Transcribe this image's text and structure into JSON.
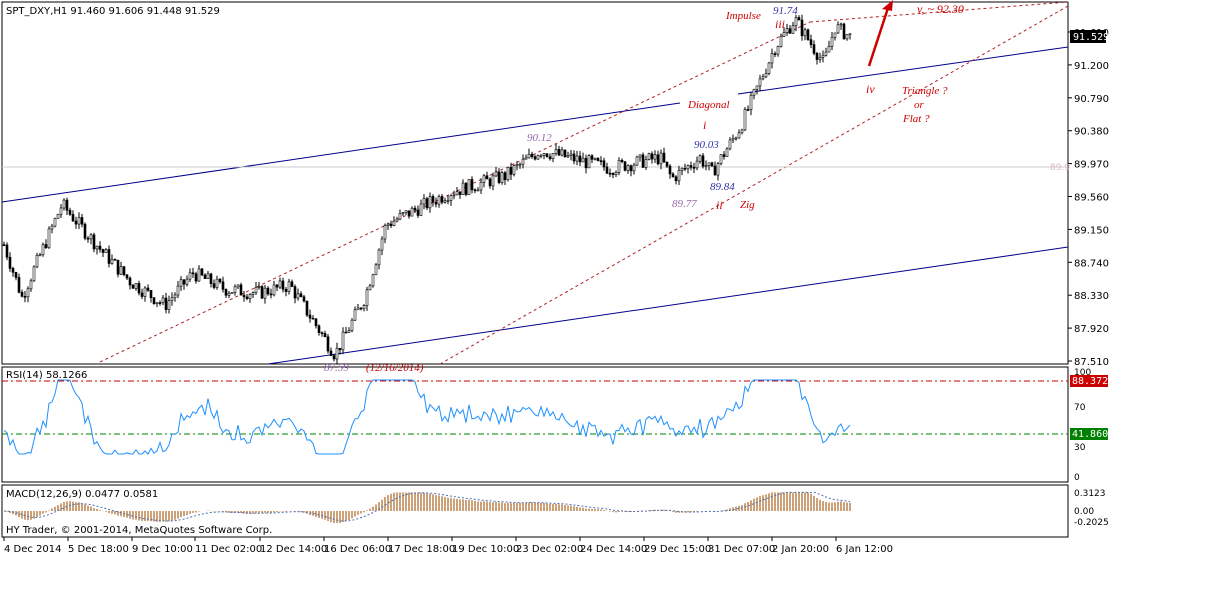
{
  "window": {
    "symbol_header": "SPT_DXY,H1  91.460 91.606 91.448 91.529",
    "copyright": "HY Trader, © 2001-2014, MetaQuotes Software Corp."
  },
  "price_axis": {
    "ticks": [
      "91.610",
      "91.200",
      "90.790",
      "90.380",
      "89.970",
      "89.560",
      "89.150",
      "88.740",
      "88.330",
      "87.920",
      "87.510"
    ],
    "current_price": "91.529",
    "faint_level_label": "89.9"
  },
  "rsi": {
    "header": "RSI(14) 58.1266",
    "ticks": [
      "100",
      "70",
      "30",
      "0"
    ],
    "upper_level": "88.3721",
    "lower_level": "41.8605"
  },
  "macd": {
    "header": "MACD(12,26,9) 0.0477 0.0581",
    "ticks": [
      "0.3123",
      "0.00",
      "-0.2025"
    ]
  },
  "time_axis": [
    "4 Dec 2014",
    "5 Dec 18:00",
    "9 Dec 10:00",
    "11 Dec 02:00",
    "12 Dec 14:00",
    "16 Dec 06:00",
    "17 Dec 18:00",
    "19 Dec 10:00",
    "23 Dec 02:00",
    "24 Dec 14:00",
    "29 Dec 15:00",
    "31 Dec 07:00",
    "2 Jan 20:00",
    "6 Jan 12:00"
  ],
  "annotations": {
    "low_price": "87.59",
    "low_date": "(12/16/2014)",
    "peak_1": "90.12",
    "wave_low_1": "89.77",
    "wave_high_2": "90.03",
    "wave_low_2": "89.84",
    "diagonal": "Diagonal",
    "wave_i": "i",
    "wave_ii": "ii",
    "zig": "Zig",
    "impulse": "Impulse",
    "wave_iii": "iii",
    "top_price": "91.74",
    "wave_iv": "iv",
    "target": "v, ~ 92.30",
    "triangle": "Triangle  ?",
    "or": "or",
    "flat": "Flat ?"
  },
  "colors": {
    "candles": "#000000",
    "channel_blue": "#00008b",
    "channel_red_dashed": "#b22222",
    "rsi_line": "#1e90ff",
    "rsi_upper_level": "#cc0000",
    "rsi_lower_level": "#008000",
    "macd_histogram": "#c08a5a",
    "annotation_red": "#cc0000",
    "annotation_blue": "#3333aa",
    "annotation_purple": "#9966aa"
  },
  "chart_data": {
    "type": "candlestick",
    "instrument": "SPT_DXY",
    "timeframe": "H1",
    "ylim": [
      87.51,
      91.61
    ],
    "x_tick_labels": [
      "4 Dec 2014",
      "5 Dec 18:00",
      "9 Dec 10:00",
      "11 Dec 02:00",
      "12 Dec 14:00",
      "16 Dec 06:00",
      "17 Dec 18:00",
      "19 Dec 10:00",
      "23 Dec 02:00",
      "24 Dec 14:00",
      "29 Dec 15:00",
      "31 Dec 07:00",
      "2 Jan 20:00",
      "6 Jan 12:00"
    ],
    "price_path": [
      [
        "4 Dec 2014",
        88.95
      ],
      [
        "5 Dec 06:00",
        88.3
      ],
      [
        "5 Dec 18:00",
        89.45
      ],
      [
        "8 Dec 12:00",
        88.9
      ],
      [
        "9 Dec 10:00",
        88.5
      ],
      [
        "10 Dec 08:00",
        88.2
      ],
      [
        "11 Dec 02:00",
        88.6
      ],
      [
        "12 Dec 00:00",
        88.4
      ],
      [
        "12 Dec 14:00",
        88.35
      ],
      [
        "15 Dec 10:00",
        88.45
      ],
      [
        "16 Dec 06:00",
        87.59
      ],
      [
        "17 Dec 06:00",
        88.3
      ],
      [
        "17 Dec 18:00",
        89.2
      ],
      [
        "19 Dec 10:00",
        89.6
      ],
      [
        "22 Dec 06:00",
        89.8
      ],
      [
        "23 Dec 02:00",
        90.12
      ],
      [
        "24 Dec 14:00",
        89.9
      ],
      [
        "29 Dec 00:00",
        90.03
      ],
      [
        "29 Dec 15:00",
        89.77
      ],
      [
        "30 Dec 12:00",
        90.03
      ],
      [
        "31 Dec 00:00",
        89.84
      ],
      [
        "31 Dec 07:00",
        90.4
      ],
      [
        "2 Jan 06:00",
        91.4
      ],
      [
        "2 Jan 20:00",
        91.74
      ],
      [
        "5 Jan 10:00",
        91.2
      ],
      [
        "6 Jan 00:00",
        91.65
      ],
      [
        "6 Jan 12:00",
        91.529
      ]
    ],
    "last_bar": {
      "open": 91.46,
      "high": 91.606,
      "low": 91.448,
      "close": 91.529
    },
    "indicators": {
      "rsi": {
        "period": 14,
        "last": 58.1266,
        "levels": [
          88.3721,
          41.8605
        ],
        "ylim": [
          0,
          100
        ]
      },
      "macd": {
        "params": [
          12,
          26,
          9
        ],
        "main": 0.0477,
        "signal": 0.0581,
        "ylim": [
          -0.2025,
          0.3123
        ]
      }
    }
  }
}
